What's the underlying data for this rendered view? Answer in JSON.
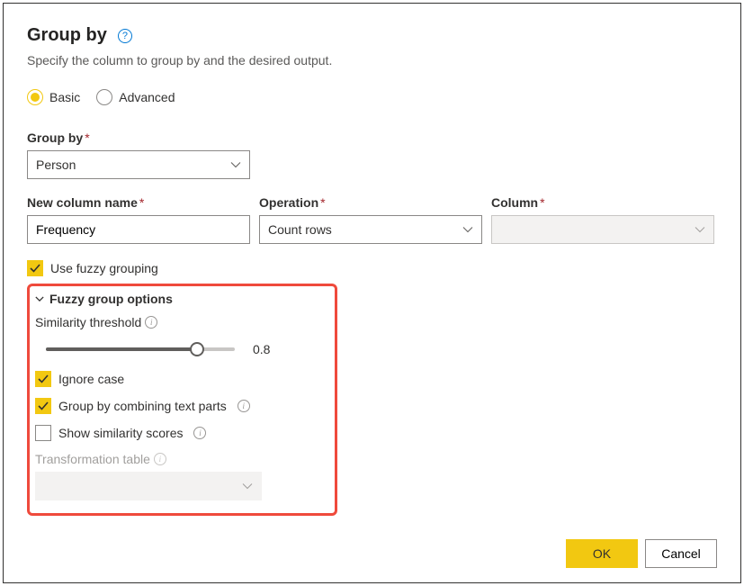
{
  "header": {
    "title": "Group by",
    "subtitle": "Specify the column to group by and the desired output."
  },
  "mode": {
    "basic": "Basic",
    "advanced": "Advanced"
  },
  "group_by": {
    "label": "Group by",
    "value": "Person"
  },
  "new_col": {
    "label": "New column name",
    "value": "Frequency"
  },
  "operation": {
    "label": "Operation",
    "value": "Count rows"
  },
  "column": {
    "label": "Column",
    "value": ""
  },
  "use_fuzzy": {
    "label": "Use fuzzy grouping"
  },
  "fuzzy": {
    "header": "Fuzzy group options",
    "similarity_label": "Similarity threshold",
    "similarity_value": "0.8",
    "ignore_case": "Ignore case",
    "combine_parts": "Group by combining text parts",
    "show_scores": "Show similarity scores",
    "transform_label": "Transformation table"
  },
  "buttons": {
    "ok": "OK",
    "cancel": "Cancel"
  }
}
